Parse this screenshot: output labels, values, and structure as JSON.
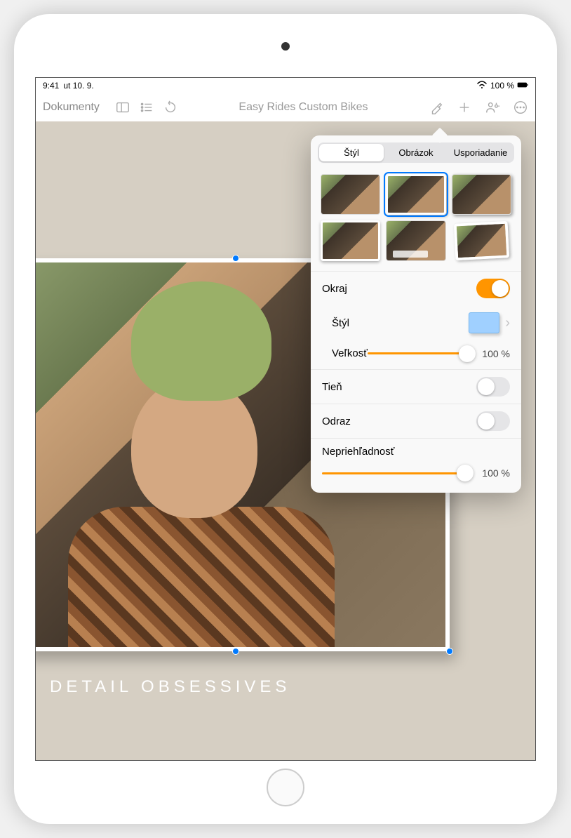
{
  "status": {
    "time": "9:41",
    "date": "ut 10. 9.",
    "battery": "100 %"
  },
  "toolbar": {
    "documents": "Dokumenty",
    "title": "Easy Rides Custom Bikes"
  },
  "canvas": {
    "caption": "DETAIL OBSESSIVES"
  },
  "popover": {
    "tabs": {
      "style": "Štýl",
      "image": "Obrázok",
      "arrange": "Usporiadanie"
    },
    "border": {
      "label": "Okraj",
      "on": true
    },
    "style_row": {
      "label": "Štýl"
    },
    "size": {
      "label": "Veľkosť",
      "value": "100 %",
      "percent": 100
    },
    "shadow": {
      "label": "Tieň",
      "on": false
    },
    "reflection": {
      "label": "Odraz",
      "on": false
    },
    "opacity": {
      "label": "Nepriehľadnosť",
      "value": "100 %",
      "percent": 100
    }
  }
}
